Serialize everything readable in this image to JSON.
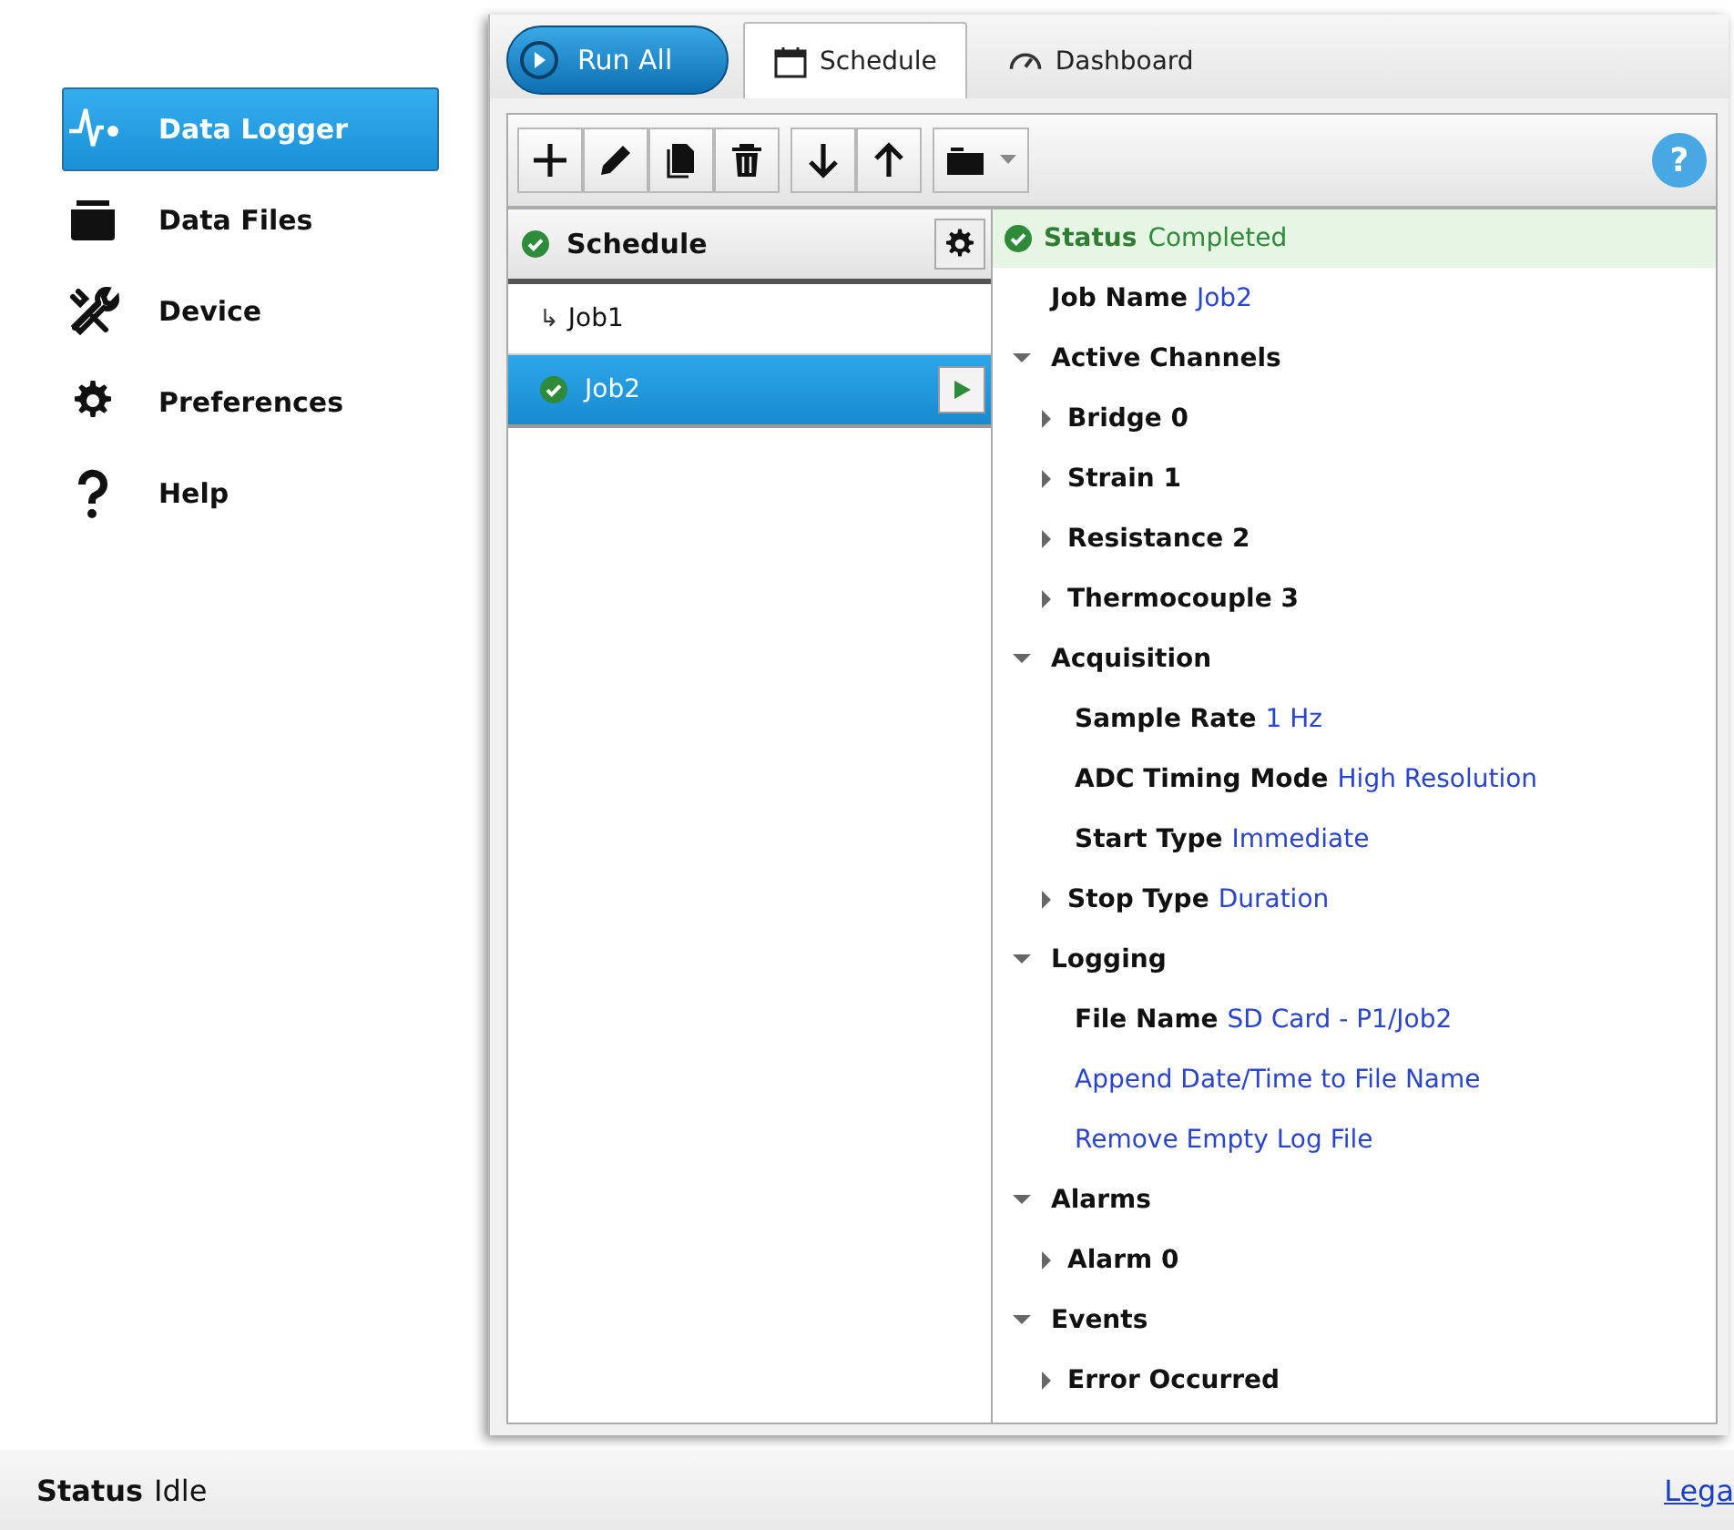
{
  "sidebar": {
    "items": [
      {
        "label": "Data Logger",
        "selected": true
      },
      {
        "label": "Data Files",
        "selected": false
      },
      {
        "label": "Device",
        "selected": false
      },
      {
        "label": "Preferences",
        "selected": false
      },
      {
        "label": "Help",
        "selected": false
      }
    ]
  },
  "run_all_button": "Run All",
  "tabs": [
    {
      "label": "Schedule",
      "selected": true
    },
    {
      "label": "Dashboard",
      "selected": false
    }
  ],
  "help_button": "?",
  "schedule": {
    "title": "Schedule",
    "jobs": [
      {
        "marker": "↳",
        "name": "Job1",
        "completed": false,
        "selected": false
      },
      {
        "name": "Job2",
        "completed": true,
        "selected": true
      }
    ]
  },
  "status": {
    "label": "Status",
    "value": "Completed"
  },
  "properties": [
    {
      "label": "Job Name",
      "value": "Job2"
    },
    {
      "label": "Active Channels",
      "expanded": true,
      "children": [
        {
          "label": "Bridge 0",
          "expanded": false
        },
        {
          "label": "Strain 1",
          "expanded": false
        },
        {
          "label": "Resistance 2",
          "expanded": false
        },
        {
          "label": "Thermocouple 3",
          "expanded": false
        }
      ]
    },
    {
      "label": "Acquisition",
      "expanded": true,
      "children": [
        {
          "label": "Sample Rate",
          "value": "1 Hz"
        },
        {
          "label": "ADC Timing Mode",
          "value": "High Resolution"
        },
        {
          "label": "Start Type",
          "value": "Immediate"
        },
        {
          "label": "Stop Type",
          "value": "Duration",
          "expanded": false
        }
      ]
    },
    {
      "label": "Logging",
      "expanded": true,
      "children": [
        {
          "label": "File Name",
          "value": "SD Card - P1/Job2"
        },
        {
          "value": "Append Date/Time to File Name"
        },
        {
          "value": "Remove Empty Log File"
        }
      ]
    },
    {
      "label": "Alarms",
      "expanded": true,
      "children": [
        {
          "label": "Alarm 0",
          "expanded": false
        }
      ]
    },
    {
      "label": "Events",
      "expanded": true,
      "children": [
        {
          "label": "Error Occurred",
          "expanded": false
        }
      ]
    }
  ],
  "status_bar": {
    "label": "Status",
    "value": "Idle",
    "link": "Lega"
  }
}
